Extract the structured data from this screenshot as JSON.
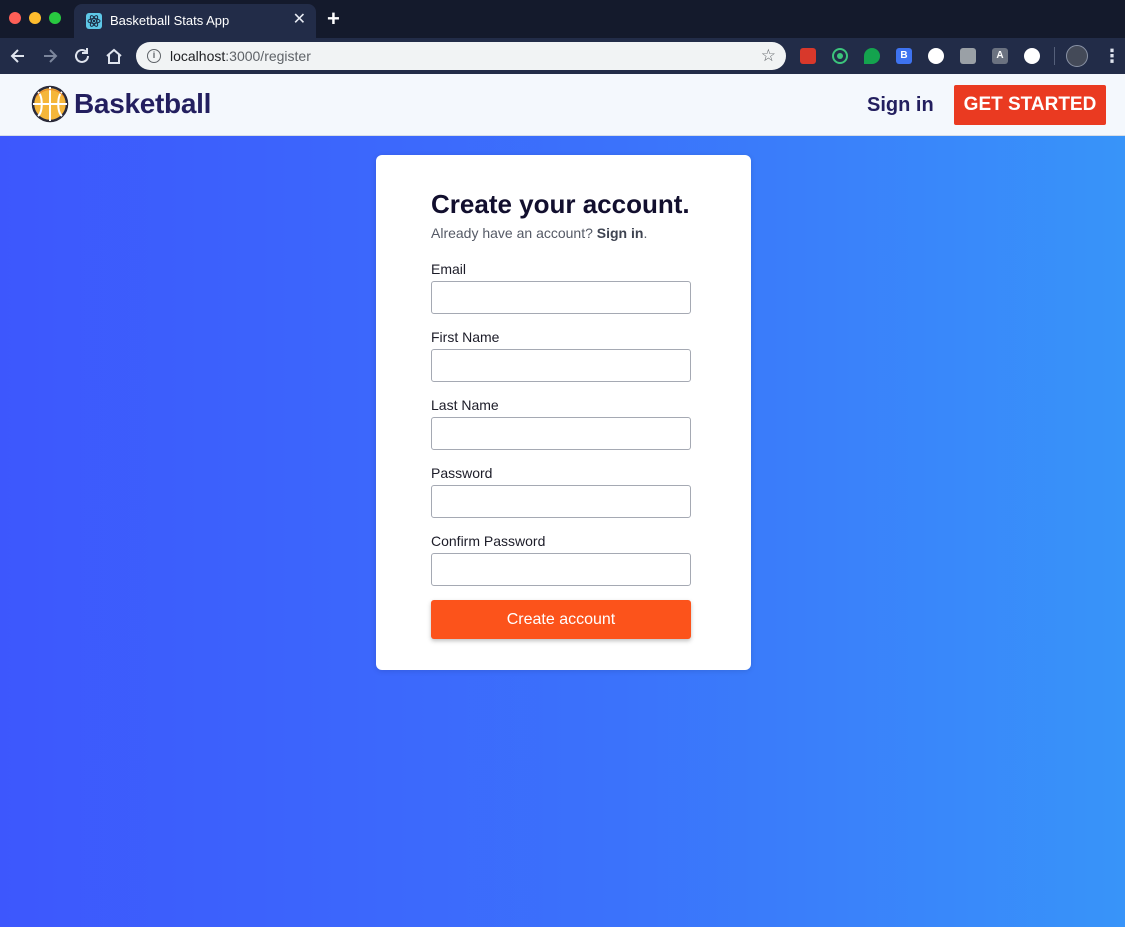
{
  "browser": {
    "tab_title": "Basketball Stats App",
    "tab_close": "✕",
    "new_tab": "+",
    "url_host": "localhost",
    "url_path": ":3000/register",
    "extensions": [
      "extension-icon",
      "extension-icon",
      "extension-icon",
      "B",
      "extension-icon",
      "extension-icon",
      "A",
      "extension-icon"
    ]
  },
  "header": {
    "brand": "Basketball",
    "signin": "Sign in",
    "get_started": "GET STARTED"
  },
  "form": {
    "title": "Create your account.",
    "subtitle_prefix": "Already have an account? ",
    "subtitle_link": "Sign in",
    "subtitle_suffix": ".",
    "fields": [
      {
        "label": "Email",
        "value": "",
        "placeholder": ""
      },
      {
        "label": "First Name",
        "value": "",
        "placeholder": ""
      },
      {
        "label": "Last Name",
        "value": "",
        "placeholder": ""
      },
      {
        "label": "Password",
        "value": "",
        "placeholder": ""
      },
      {
        "label": "Confirm Password",
        "value": "",
        "placeholder": ""
      }
    ],
    "submit": "Create account"
  },
  "colors": {
    "brand_navy": "#231f5f",
    "cta_red": "#ea3a21",
    "submit_orange": "#fc531b",
    "bg_gradient_start": "#3d57fd",
    "bg_gradient_end": "#3894f9"
  }
}
